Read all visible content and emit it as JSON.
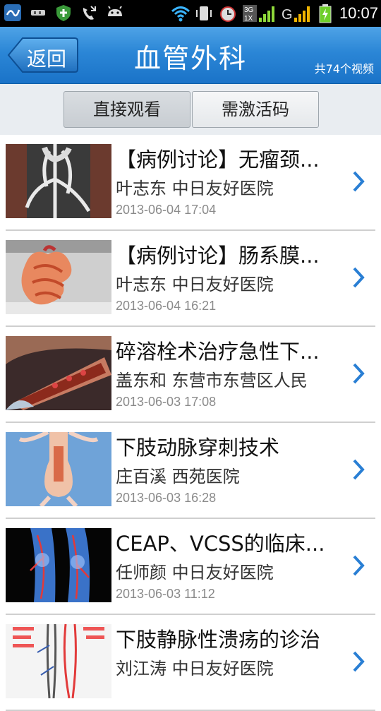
{
  "status_bar": {
    "time": "10:07",
    "icons": [
      "app-icon",
      "usb-icon",
      "shield-icon",
      "missed-call-icon",
      "android-icon",
      "wifi-icon",
      "vibrate-icon",
      "alarm-icon",
      "3g-signal-icon",
      "gps-signal-icon",
      "battery-charging-icon"
    ],
    "network_label": "3G 1X"
  },
  "header": {
    "back_label": "返回",
    "title": "血管外科",
    "count_label": "共74个视频"
  },
  "segments": {
    "direct_label": "直接观看",
    "activation_label": "需激活码"
  },
  "videos": [
    {
      "title": "【病例讨论】无瘤颈...",
      "author": "叶志东 中日友好医院",
      "date": "2013-06-04 17:04"
    },
    {
      "title": "【病例讨论】肠系膜...",
      "author": "叶志东 中日友好医院",
      "date": "2013-06-04 16:21"
    },
    {
      "title": "碎溶栓术治疗急性下...",
      "author": "盖东和 东营市东营区人民",
      "date": "2013-06-03 17:08"
    },
    {
      "title": "下肢动脉穿刺技术",
      "author": "庄百溪 西苑医院",
      "date": "2013-06-03 16:28"
    },
    {
      "title": "CEAP、VCSS的临床...",
      "author": "任师颜 中日友好医院",
      "date": "2013-06-03 11:12"
    },
    {
      "title": "下肢静脉性溃疡的诊治",
      "author": "刘江涛 中日友好医院",
      "date": ""
    }
  ],
  "colors": {
    "header_blue": "#2b86d6",
    "chevron_blue": "#2a7fd4"
  }
}
